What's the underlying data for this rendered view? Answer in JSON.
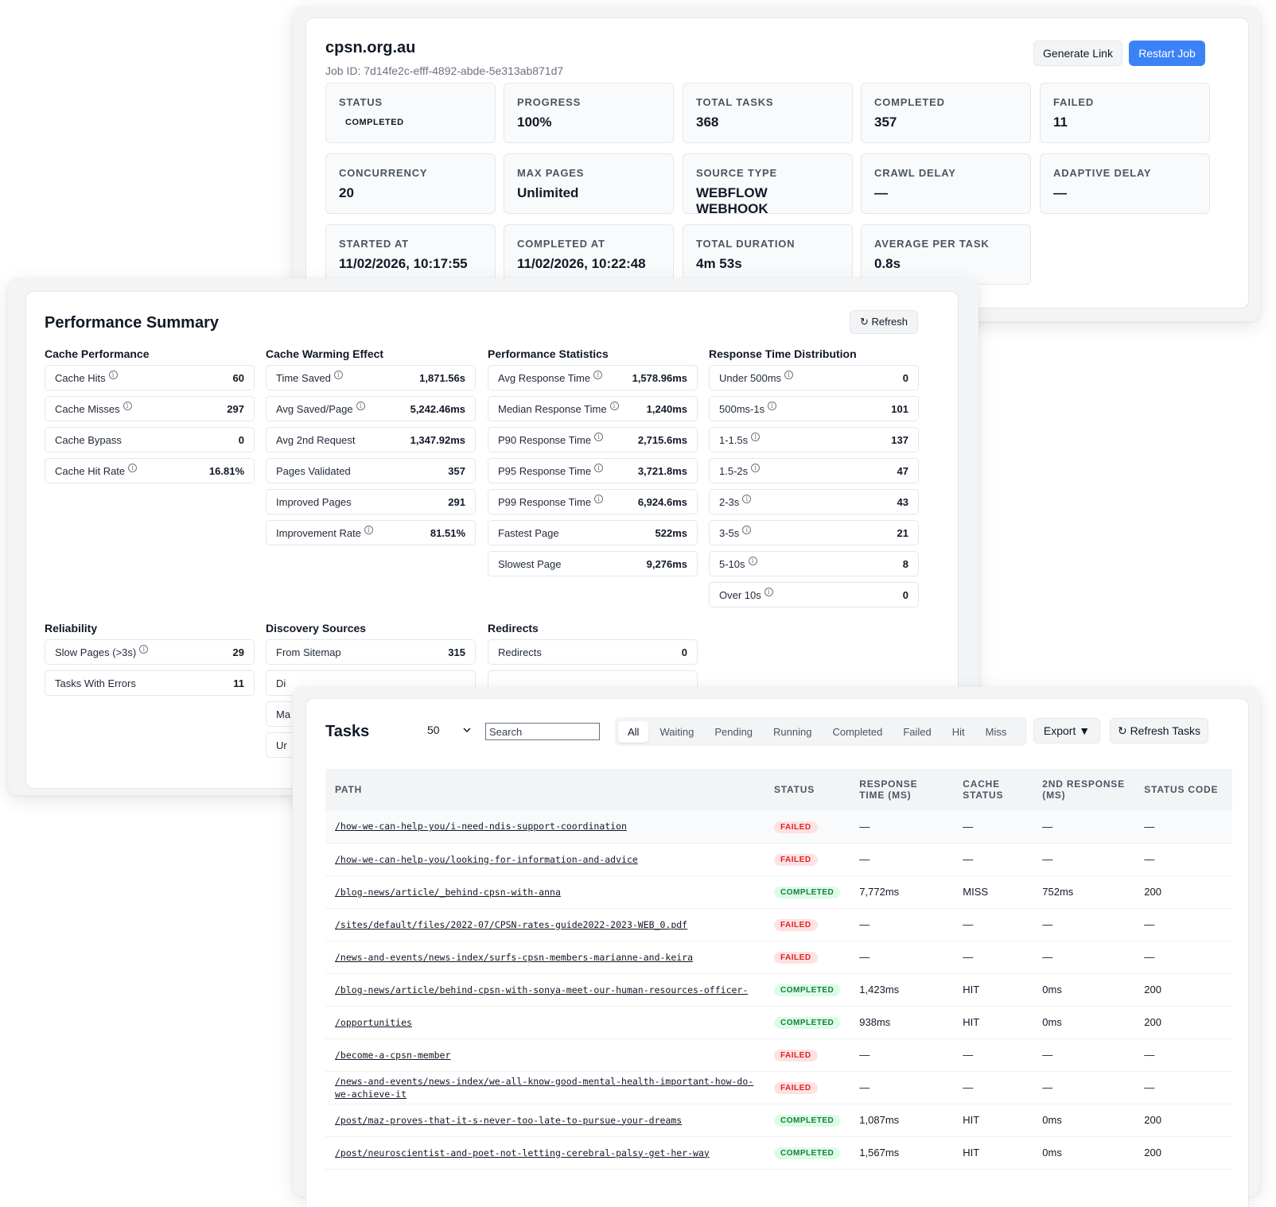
{
  "job": {
    "title": "cpsn.org.au",
    "job_id": "Job ID: 7d14fe2c-efff-4892-abde-5e313ab871d7",
    "generate_link": "Generate Link",
    "restart_job": "Restart Job",
    "stats": [
      {
        "label": "Status",
        "value": "COMPLETED"
      },
      {
        "label": "Progress",
        "value": "100%"
      },
      {
        "label": "Total Tasks",
        "value": "368"
      },
      {
        "label": "Completed",
        "value": "357"
      },
      {
        "label": "Failed",
        "value": "11"
      },
      {
        "label": "Concurrency",
        "value": "20"
      },
      {
        "label": "Max Pages",
        "value": "Unlimited"
      },
      {
        "label": "Source Type",
        "value": "WEBFLOW WEBHOOK"
      },
      {
        "label": "Crawl Delay",
        "value": "—"
      },
      {
        "label": "Adaptive Delay",
        "value": "—"
      },
      {
        "label": "Started At",
        "value": "11/02/2026, 10:17:55"
      },
      {
        "label": "Completed At",
        "value": "11/02/2026, 10:22:48"
      },
      {
        "label": "Total Duration",
        "value": "4m 53s"
      },
      {
        "label": "Average Per Task",
        "value": "0.8s"
      }
    ]
  },
  "perf": {
    "title": "Performance Summary",
    "refresh": "↻ Refresh",
    "cache_performance": {
      "heading": "Cache Performance",
      "rows": [
        {
          "label": "Cache Hits",
          "value": "60"
        },
        {
          "label": "Cache Misses",
          "value": "297"
        },
        {
          "label": "Cache Bypass",
          "value": "0"
        },
        {
          "label": "Cache Hit Rate",
          "value": "16.81%"
        }
      ]
    },
    "cache_warming": {
      "heading": "Cache Warming Effect",
      "rows": [
        {
          "label": "Time Saved",
          "value": "1,871.56s"
        },
        {
          "label": "Avg Saved/Page",
          "value": "5,242.46ms"
        },
        {
          "label": "Avg 2nd Request",
          "value": "1,347.92ms"
        },
        {
          "label": "Pages Validated",
          "value": "357"
        },
        {
          "label": "Improved Pages",
          "value": "291"
        },
        {
          "label": "Improvement Rate",
          "value": "81.51%"
        }
      ]
    },
    "performance_stats": {
      "heading": "Performance Statistics",
      "rows": [
        {
          "label": "Avg Response Time",
          "value": "1,578.96ms"
        },
        {
          "label": "Median Response Time",
          "value": "1,240ms"
        },
        {
          "label": "P90 Response Time",
          "value": "2,715.6ms"
        },
        {
          "label": "P95 Response Time",
          "value": "3,721.8ms"
        },
        {
          "label": "P99 Response Time",
          "value": "6,924.6ms"
        },
        {
          "label": "Fastest Page",
          "value": "522ms"
        },
        {
          "label": "Slowest Page",
          "value": "9,276ms"
        }
      ]
    },
    "response_distribution": {
      "heading": "Response Time Distribution",
      "rows": [
        {
          "label": "Under 500ms",
          "value": "0"
        },
        {
          "label": "500ms-1s",
          "value": "101"
        },
        {
          "label": "1-1.5s",
          "value": "137"
        },
        {
          "label": "1.5-2s",
          "value": "47"
        },
        {
          "label": "2-3s",
          "value": "43"
        },
        {
          "label": "3-5s",
          "value": "21"
        },
        {
          "label": "5-10s",
          "value": "8"
        },
        {
          "label": "Over 10s",
          "value": "0"
        }
      ]
    },
    "reliability": {
      "heading": "Reliability",
      "rows": [
        {
          "label": "Slow Pages (>3s)",
          "value": "29"
        },
        {
          "label": "Tasks With Errors",
          "value": "11"
        }
      ]
    },
    "discovery": {
      "heading": "Discovery Sources",
      "rows": [
        {
          "label": "From Sitemap",
          "value": "315"
        },
        {
          "label": "Di"
        },
        {
          "label": "Ma"
        },
        {
          "label": "Ur"
        }
      ]
    },
    "redirects": {
      "heading": "Redirects",
      "rows": [
        {
          "label": "Redirects",
          "value": "0"
        }
      ]
    }
  },
  "tasks": {
    "title": "Tasks",
    "page_size": "50",
    "search_placeholder": "Search",
    "filters": [
      "All",
      "Waiting",
      "Pending",
      "Running",
      "Completed",
      "Failed",
      "Hit",
      "Miss"
    ],
    "export": "Export ▼",
    "refresh_tasks": "↻ Refresh Tasks",
    "columns": [
      "Path",
      "Status",
      "Response Time (ms)",
      "Cache Status",
      "2nd Response (ms)",
      "Status Code"
    ],
    "rows": [
      {
        "path": "/how-we-can-help-you/i-need-ndis-support-coordination",
        "status": "FAILED",
        "response": "—",
        "cache": "—",
        "second": "—",
        "code": "—"
      },
      {
        "path": "/how-we-can-help-you/looking-for-information-and-advice",
        "status": "FAILED",
        "response": "—",
        "cache": "—",
        "second": "—",
        "code": "—"
      },
      {
        "path": "/blog-news/article/_behind-cpsn-with-anna",
        "status": "COMPLETED",
        "response": "7,772ms",
        "cache": "MISS",
        "second": "752ms",
        "code": "200"
      },
      {
        "path": "/sites/default/files/2022-07/CPSN-rates-guide2022-2023-WEB_0.pdf",
        "status": "FAILED",
        "response": "—",
        "cache": "—",
        "second": "—",
        "code": "—"
      },
      {
        "path": "/news-and-events/news-index/surfs-cpsn-members-marianne-and-keira",
        "status": "FAILED",
        "response": "—",
        "cache": "—",
        "second": "—",
        "code": "—"
      },
      {
        "path": "/blog-news/article/behind-cpsn-with-sonya-meet-our-human-resources-officer-",
        "status": "COMPLETED",
        "response": "1,423ms",
        "cache": "HIT",
        "second": "0ms",
        "code": "200"
      },
      {
        "path": "/opportunities",
        "status": "COMPLETED",
        "response": "938ms",
        "cache": "HIT",
        "second": "0ms",
        "code": "200"
      },
      {
        "path": "/become-a-cpsn-member",
        "status": "FAILED",
        "response": "—",
        "cache": "—",
        "second": "—",
        "code": "—"
      },
      {
        "path": "/news-and-events/news-index/we-all-know-good-mental-health-important-how-do-we-achieve-it",
        "status": "FAILED",
        "response": "—",
        "cache": "—",
        "second": "—",
        "code": "—"
      },
      {
        "path": "/post/maz-proves-that-it-s-never-too-late-to-pursue-your-dreams",
        "status": "COMPLETED",
        "response": "1,087ms",
        "cache": "HIT",
        "second": "0ms",
        "code": "200"
      },
      {
        "path": "/post/neuroscientist-and-poet-not-letting-cerebral-palsy-get-her-way",
        "status": "COMPLETED",
        "response": "1,567ms",
        "cache": "HIT",
        "second": "0ms",
        "code": "200"
      }
    ]
  }
}
